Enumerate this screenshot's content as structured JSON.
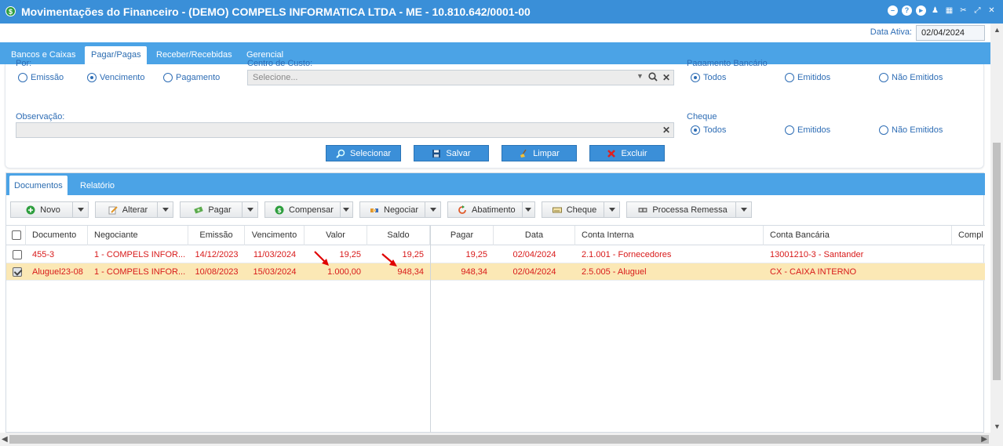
{
  "window": {
    "title": "Movimentações do Financeiro - (DEMO) COMPELS INFORMATICA LTDA - ME - 10.810.642/0001-00",
    "app_icon": "$"
  },
  "header": {
    "data_ativa_label": "Data Ativa:",
    "data_ativa_value": "02/04/2024"
  },
  "tabs": [
    "Bancos e Caixas",
    "Pagar/Pagas",
    "Receber/Recebidas",
    "Gerencial"
  ],
  "filters": {
    "por_label": "Por:",
    "por_options": [
      "Emissão",
      "Vencimento",
      "Pagamento"
    ],
    "centro_label": "Centro de Custo:",
    "centro_placeholder": "Selecione...",
    "pag_bancario_label": "Pagamento Bancário",
    "pag_bancario_options": [
      "Todos",
      "Emitidos",
      "Não Emitidos"
    ],
    "observacao_label": "Observação:",
    "cheque_label": "Cheque",
    "cheque_options": [
      "Todos",
      "Emitidos",
      "Não Emitidos"
    ]
  },
  "actions": {
    "selecionar": "Selecionar",
    "salvar": "Salvar",
    "limpar": "Limpar",
    "excluir": "Excluir"
  },
  "doc_tabs": [
    "Documentos",
    "Relatório"
  ],
  "toolbar": {
    "novo": "Novo",
    "alterar": "Alterar",
    "pagar": "Pagar",
    "compensar": "Compensar",
    "negociar": "Negociar",
    "abatimento": "Abatimento",
    "cheque": "Cheque",
    "processa_remessa": "Processa Remessa"
  },
  "grid": {
    "columns": [
      "Documento",
      "Negociante",
      "Emissão",
      "Vencimento",
      "Valor",
      "Saldo",
      "Pagar",
      "Data",
      "Conta Interna",
      "Conta Bancária",
      "Compl"
    ],
    "rows": [
      {
        "checked": false,
        "documento": "455-3",
        "negociante": "1 - COMPELS INFOR...",
        "emissao": "14/12/2023",
        "vencimento": "11/03/2024",
        "valor": "19,25",
        "saldo": "19,25",
        "pagar": "19,25",
        "data": "02/04/2024",
        "conta_interna": "2.1.001 - Fornecedores",
        "conta_bancaria": "13001210-3 - Santander"
      },
      {
        "checked": true,
        "documento": "Aluguel23-08",
        "negociante": "1 - COMPELS INFOR...",
        "emissao": "10/08/2023",
        "vencimento": "15/03/2024",
        "valor": "1.000,00",
        "saldo": "948,34",
        "pagar": "948,34",
        "data": "02/04/2024",
        "conta_interna": "2.5.005 - Aluguel",
        "conta_bancaria": "CX - CAIXA INTERNO"
      }
    ]
  },
  "colors": {
    "titlebar": "#3a8fd8",
    "tabbar": "#4ba3e6",
    "row_text": "#d81a1a",
    "selected_row": "#fbe8b5",
    "annotation_arrow": "#e00000"
  }
}
